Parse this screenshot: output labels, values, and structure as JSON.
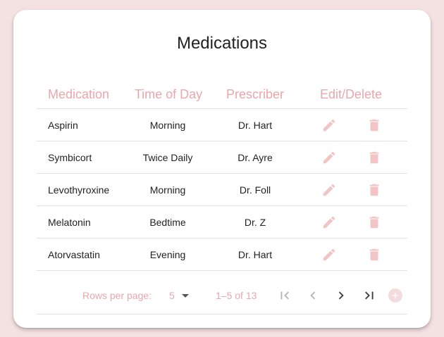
{
  "title": "Medications",
  "columns": {
    "medication": "Medication",
    "time_of_day": "Time of Day",
    "prescriber": "Prescriber",
    "actions": "Edit/Delete"
  },
  "rows": [
    {
      "medication": "Aspirin",
      "time_of_day": "Morning",
      "prescriber": "Dr. Hart"
    },
    {
      "medication": "Symbicort",
      "time_of_day": "Twice Daily",
      "prescriber": "Dr. Ayre"
    },
    {
      "medication": "Levothyroxine",
      "time_of_day": "Morning",
      "prescriber": "Dr. Foll"
    },
    {
      "medication": "Melatonin",
      "time_of_day": "Bedtime",
      "prescriber": "Dr. Z"
    },
    {
      "medication": "Atorvastatin",
      "time_of_day": "Evening",
      "prescriber": "Dr. Hart"
    }
  ],
  "pagination": {
    "rows_per_page_label": "Rows per page:",
    "rows_per_page_value": "5",
    "range_text": "1–5 of 13"
  },
  "icons": {
    "edit": "pencil-icon",
    "delete": "trash-icon",
    "first_page": "first-page-icon",
    "previous_page": "chevron-left-icon",
    "next_page": "chevron-right-icon",
    "last_page": "last-page-icon",
    "add": "add-circle-icon",
    "dropdown": "caret-down-icon"
  },
  "colors": {
    "background": "#f4e1e2",
    "accent": "#e8a8ab",
    "icon": "#f2c4c6"
  }
}
